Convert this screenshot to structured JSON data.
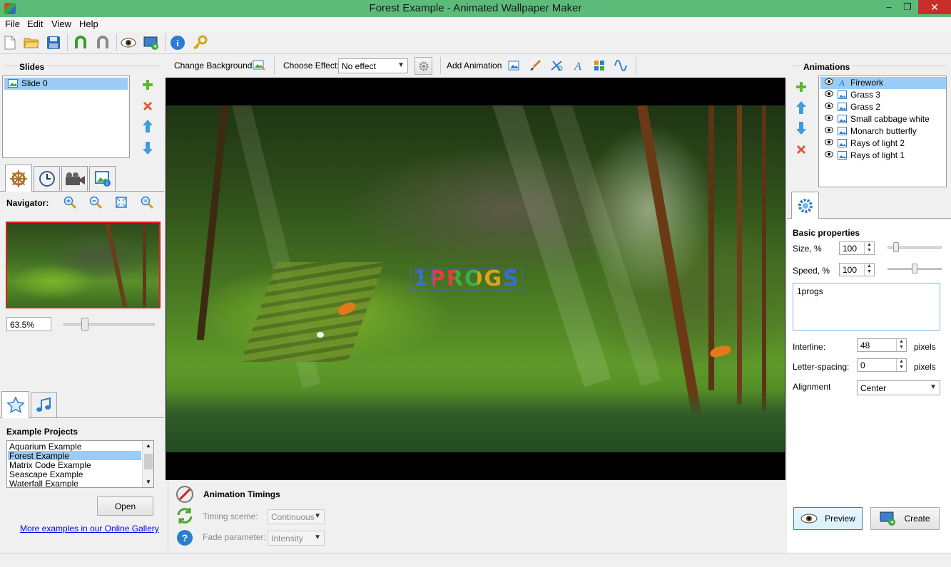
{
  "window": {
    "title": "Forest Example - Animated Wallpaper Maker",
    "minimize": "–",
    "maximize": "❐",
    "close": "✕"
  },
  "menu": {
    "file": "File",
    "edit": "Edit",
    "view": "View",
    "help": "Help"
  },
  "toolbar": {
    "icons": [
      "new-icon",
      "open-folder-icon",
      "save-icon",
      "undo-icon",
      "redo-icon",
      "preview-eye-icon",
      "create-wallpaper-icon",
      "info-icon",
      "key-icon"
    ]
  },
  "slides": {
    "title": "Slides",
    "items": [
      {
        "label": "Slide 0"
      }
    ]
  },
  "navigator": {
    "label": "Navigator:",
    "zoom": "63.5%"
  },
  "projects": {
    "title": "Example Projects",
    "items": [
      "Aquarium Example",
      "Forest Example",
      "Matrix Code Example",
      "Seascape Example",
      "Waterfall Example"
    ],
    "selected_index": 1,
    "open_label": "Open",
    "gallery_link": "More examples in our Online Gallery"
  },
  "canvas_toolbar": {
    "change_background": "Change Background",
    "choose_effect_label": "Choose Effect:",
    "effect_value": "No effect",
    "add_animation": "Add Animation"
  },
  "canvas": {
    "overlay_text": "1PROGS"
  },
  "timings": {
    "title": "Animation Timings",
    "timing_label": "Timing sceme:",
    "timing_value": "Continuous",
    "fade_label": "Fade parameter:",
    "fade_value": "Intensity"
  },
  "animations": {
    "title": "Animations",
    "items": [
      "Firework",
      "Grass 3",
      "Grass 2",
      "Small cabbage white",
      "Monarch butterfly",
      "Rays of light 2",
      "Rays of light 1"
    ],
    "selected_index": 0
  },
  "properties": {
    "title": "Basic properties",
    "size_label": "Size, %",
    "size_value": "100",
    "size_level": 0.12,
    "speed_label": "Speed, %",
    "speed_value": "100",
    "speed_level": 0.5,
    "text_value": "1progs",
    "interline_label": "Interline:",
    "interline_value": "48",
    "interline_unit": "pixels",
    "letter_label": "Letter-spacing:",
    "letter_value": "0",
    "letter_unit": "pixels",
    "alignment_label": "Alignment",
    "alignment_value": "Center"
  },
  "actions": {
    "preview": "Preview",
    "create": "Create"
  },
  "colors": {
    "titlebar": "#5dbb7a",
    "selection": "#99cdf7",
    "close": "#c7302a",
    "link": "#0000ee"
  }
}
